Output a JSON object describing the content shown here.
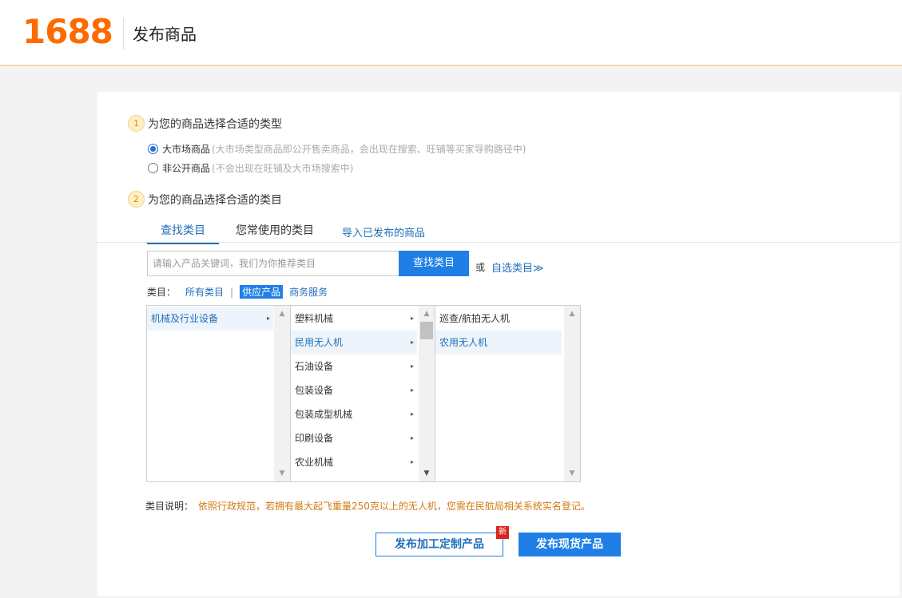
{
  "header": {
    "logo": "1688",
    "title": "发布商品"
  },
  "step1": {
    "number": "1",
    "title": "为您的商品选择合适的类型",
    "options": [
      {
        "label": "大市场商品",
        "hint": "(大市场类型商品即公开售卖商品，会出现在搜索、旺铺等买家导购路径中)",
        "checked": true
      },
      {
        "label": "非公开商品",
        "hint": "(不会出现在旺铺及大市场搜索中)",
        "checked": false
      }
    ]
  },
  "step2": {
    "number": "2",
    "title": "为您的商品选择合适的类目"
  },
  "tabs": {
    "find": "查找类目",
    "frequent": "您常使用的类目",
    "import": "导入已发布的商品"
  },
  "search": {
    "placeholder": "请输入产品关键词，我们为你推荐类目",
    "button": "查找类目",
    "or": "或",
    "custom": "自选类目≫"
  },
  "category_filter": {
    "label": "类目：",
    "options": [
      "所有类目",
      "|",
      "供应产品",
      "商务服务"
    ],
    "selected": "供应产品"
  },
  "columns": {
    "col1": [
      {
        "label": "机械及行业设备",
        "selected": true,
        "arrow": "▸"
      }
    ],
    "col2": [
      {
        "label": "塑料机械",
        "arrow": "▸"
      },
      {
        "label": "民用无人机",
        "selected": true,
        "arrow": "▸"
      },
      {
        "label": "石油设备",
        "arrow": "▸"
      },
      {
        "label": "包装设备",
        "arrow": "▸"
      },
      {
        "label": "包装成型机械",
        "arrow": "▸"
      },
      {
        "label": "印刷设备",
        "arrow": "▸"
      },
      {
        "label": "农业机械",
        "arrow": "▸"
      }
    ],
    "col3": [
      {
        "label": "巡查/航拍无人机"
      },
      {
        "label": "农用无人机",
        "selected": true
      }
    ]
  },
  "description": {
    "label": "类目说明：",
    "text": "依照行政规范，若拥有最大起飞重量250克以上的无人机，您需在民航局相关系统实名登记。"
  },
  "buttons": {
    "custom": "发布加工定制产品",
    "badge": "新",
    "stock": "发布现货产品"
  },
  "colors": {
    "brand": "#ff6a00",
    "primary": "#1f7fe6",
    "link": "#1f6fb8",
    "notice": "#d27a12"
  }
}
